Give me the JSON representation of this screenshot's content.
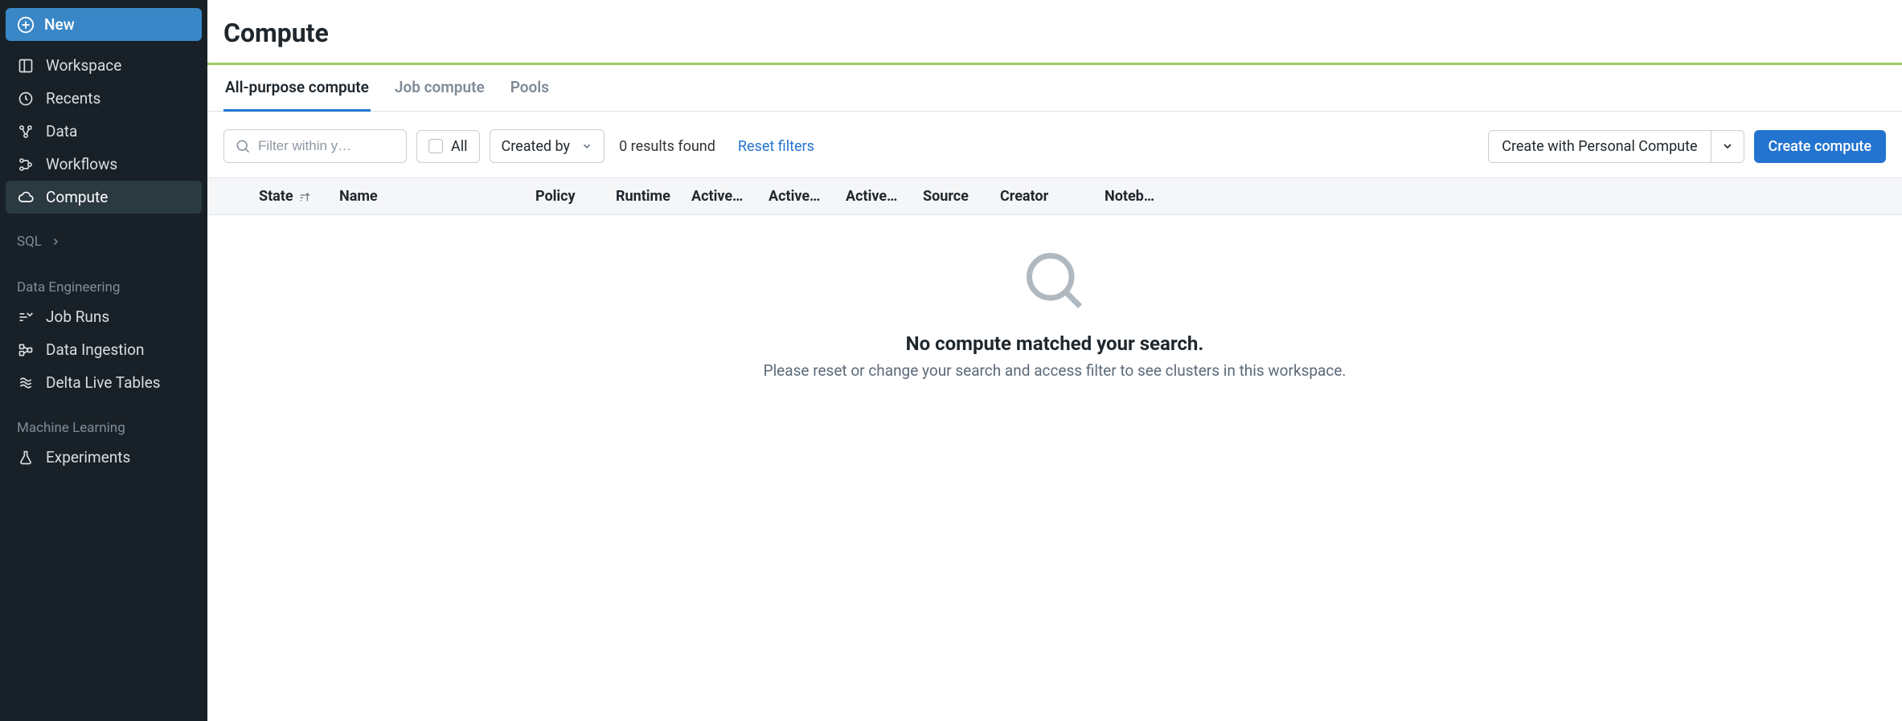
{
  "sidebar": {
    "new_label": "New",
    "items": [
      {
        "label": "Workspace"
      },
      {
        "label": "Recents"
      },
      {
        "label": "Data"
      },
      {
        "label": "Workflows"
      },
      {
        "label": "Compute"
      }
    ],
    "sql_label": "SQL",
    "de_heading": "Data Engineering",
    "de_items": [
      {
        "label": "Job Runs"
      },
      {
        "label": "Data Ingestion"
      },
      {
        "label": "Delta Live Tables"
      }
    ],
    "ml_heading": "Machine Learning",
    "ml_items": [
      {
        "label": "Experiments"
      }
    ]
  },
  "page_title": "Compute",
  "tabs": [
    {
      "label": "All-purpose compute",
      "active": true
    },
    {
      "label": "Job compute"
    },
    {
      "label": "Pools"
    }
  ],
  "toolbar": {
    "filter_placeholder": "Filter within y…",
    "all_label": "All",
    "created_by_label": "Created by",
    "results_text": "0 results found",
    "reset_label": "Reset filters",
    "personal_compute_label": "Create with Personal Compute",
    "create_label": "Create compute"
  },
  "columns": {
    "state": "State",
    "name": "Name",
    "policy": "Policy",
    "runtime": "Runtime",
    "active1": "Active…",
    "active2": "Active…",
    "active3": "Active…",
    "source": "Source",
    "creator": "Creator",
    "noteb": "Noteb…"
  },
  "empty": {
    "title": "No compute matched your search.",
    "subtitle": "Please reset or change your search and access filter to see clusters in this workspace."
  }
}
